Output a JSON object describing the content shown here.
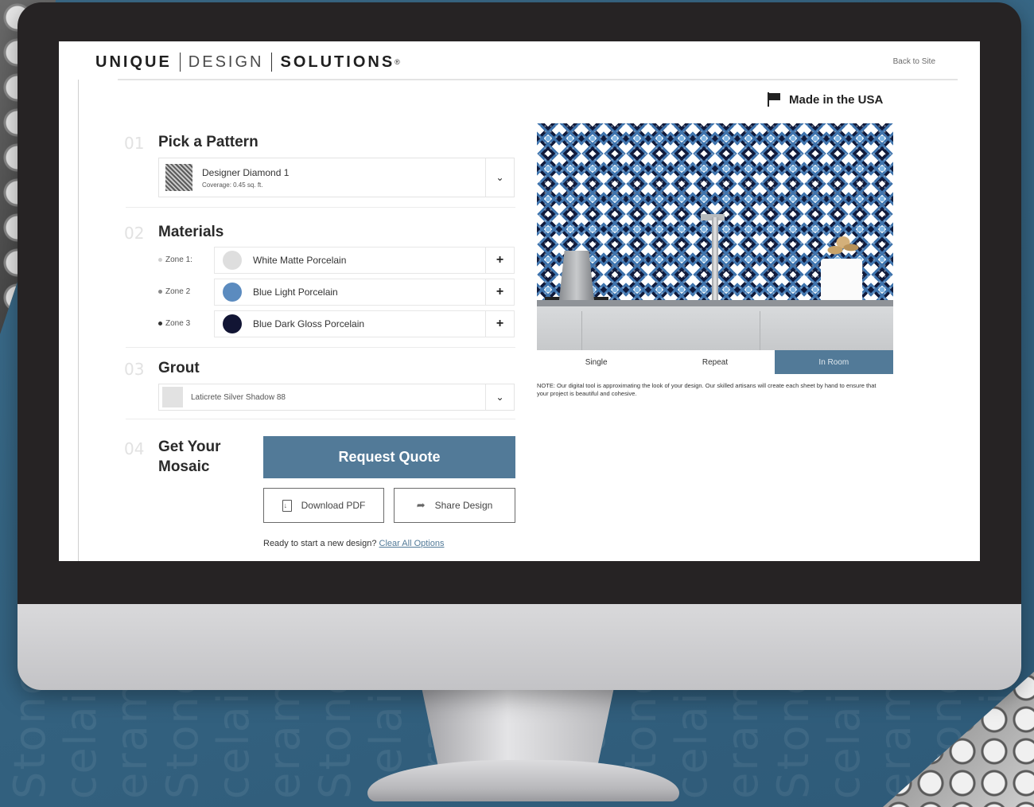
{
  "background": {
    "words": [
      "Stone",
      "celain",
      "eramic",
      "Stone",
      "celain",
      "eramic",
      "Stone",
      "celain",
      "eramic",
      "Stone",
      "celain",
      "eramic",
      "Stone",
      "celain",
      "eramic",
      "Stone",
      "celain",
      "eramic",
      "Stone",
      "celain"
    ]
  },
  "header": {
    "brand_word1": "UNIQUE",
    "brand_word2": "DESIGN",
    "brand_word3": "SOLUTIONS",
    "registered": "®",
    "back_link": "Back to Site",
    "made_in_usa": "Made in the USA"
  },
  "steps": {
    "pattern": {
      "number": "01",
      "title": "Pick a Pattern",
      "selected_name": "Designer Diamond 1",
      "selected_coverage": "Coverage: 0.45 sq. ft."
    },
    "materials": {
      "number": "02",
      "title": "Materials",
      "zones": [
        {
          "label": "Zone 1:",
          "material": "White Matte Porcelain",
          "color": "#dedede"
        },
        {
          "label": "Zone 2",
          "material": "Blue Light Porcelain",
          "color": "#5b8bbf"
        },
        {
          "label": "Zone 3",
          "material": "Blue Dark Gloss Porcelain",
          "color": "#121534"
        }
      ]
    },
    "grout": {
      "number": "03",
      "title": "Grout",
      "selected": "Laticrete Silver Shadow 88"
    },
    "get_mosaic": {
      "number": "04",
      "title_line1": "Get Your",
      "title_line2": "Mosaic",
      "request_quote": "Request Quote",
      "download_pdf": "Download PDF",
      "share_design": "Share Design",
      "reset_prompt": "Ready to start a new design?",
      "clear_all": "Clear All Options"
    }
  },
  "preview": {
    "tabs": [
      "Single",
      "Repeat",
      "In Room"
    ],
    "active_tab": "In Room",
    "note": "NOTE: Our digital tool is approximating the look of your design. Our skilled artisans will create each sheet by hand to ensure that your project is beautiful and cohesive."
  },
  "colors": {
    "accent": "#527a98",
    "background": "#3a6a8a"
  }
}
